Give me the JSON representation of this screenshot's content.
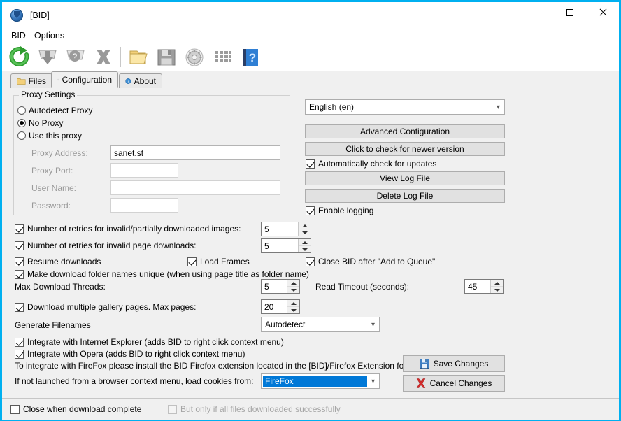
{
  "window": {
    "title": "[BID]",
    "app_icon": "bid-shield-icon",
    "minimize": "minimize-icon",
    "maximize": "maximize-icon",
    "close": "close-icon"
  },
  "menubar": {
    "items": [
      {
        "label": "BID"
      },
      {
        "label": "Options"
      }
    ]
  },
  "toolbar": {
    "items": [
      {
        "name": "refresh-icon",
        "title": "Refresh"
      },
      {
        "name": "download-icon",
        "title": "Download"
      },
      {
        "name": "help-disk-icon",
        "title": "Help"
      },
      {
        "name": "cancel-x-icon",
        "title": "Stop"
      },
      {
        "name": "folder-icon",
        "title": "Open Folder"
      },
      {
        "name": "save-floppy-icon",
        "title": "Save"
      },
      {
        "name": "gear-disc-icon",
        "title": "Settings"
      },
      {
        "name": "grid-icon",
        "title": "Thumbnails"
      },
      {
        "name": "help-book-icon",
        "title": "Help Book"
      }
    ]
  },
  "tabs": [
    {
      "label": "Files",
      "icon": "folder-icon",
      "active": false
    },
    {
      "label": "Configuration",
      "icon": "gear-icon",
      "active": true
    },
    {
      "label": "About",
      "icon": "info-icon",
      "active": false
    }
  ],
  "proxy": {
    "group_title": "Proxy Settings",
    "options": [
      {
        "label": "Autodetect Proxy",
        "checked": false
      },
      {
        "label": "No Proxy",
        "checked": true
      },
      {
        "label": "Use this proxy",
        "checked": false
      }
    ],
    "fields": [
      {
        "label": "Proxy Address:",
        "value": "sanet.st",
        "placeholder": ""
      },
      {
        "label": "Proxy Port:",
        "value": "",
        "placeholder": ""
      },
      {
        "label": "User Name:",
        "value": "",
        "placeholder": ""
      },
      {
        "label": "Password:",
        "value": "",
        "placeholder": ""
      }
    ]
  },
  "right_panel": {
    "language": {
      "value": "English (en)"
    },
    "advanced_config_button": "Advanced Configuration",
    "check_version_button": "Click to check for newer version",
    "auto_check_updates": {
      "label": "Automatically check for updates",
      "checked": true
    },
    "view_log_button": "View Log File",
    "delete_log_button": "Delete Log File",
    "enable_logging": {
      "label": "Enable logging",
      "checked": true
    }
  },
  "options": {
    "retries_images": {
      "label": "Number of retries for invalid/partially downloaded images:",
      "checked": true,
      "value": "5"
    },
    "retries_pages": {
      "label": "Number of retries for invalid page downloads:",
      "checked": true,
      "value": "5"
    },
    "resume_downloads": {
      "label": "Resume downloads",
      "checked": true
    },
    "load_frames": {
      "label": "Load Frames",
      "checked": true
    },
    "close_after_queue": {
      "label": "Close BID after \"Add to Queue\"",
      "checked": true
    },
    "unique_folder_names": {
      "label": "Make download folder names unique (when using page title as folder name)",
      "checked": true
    },
    "max_threads": {
      "label": "Max Download Threads:",
      "value": "5"
    },
    "read_timeout": {
      "label": "Read Timeout (seconds):",
      "value": "45"
    },
    "multiple_gallery": {
      "label": "Download multiple gallery pages. Max pages:",
      "checked": true,
      "value": "20"
    },
    "generate_filenames": {
      "label": "Generate Filenames",
      "value": "Autodetect"
    },
    "integrate_ie": {
      "label": "Integrate with Internet Explorer (adds BID to right click context menu)",
      "checked": true
    },
    "integrate_opera": {
      "label": "Integrate with Opera (adds BID to right click context menu)",
      "checked": true
    },
    "firefox_note": "To integrate with FireFox please install the BID Firefox extension located in the [BID]/Firefox Extension folder.",
    "cookies_label": "If not launched from a browser context menu, load cookies from:",
    "cookies_value": "FireFox"
  },
  "actions": {
    "save_label": "Save Changes",
    "save_icon": "save-floppy-icon",
    "cancel_label": "Cancel Changes",
    "cancel_icon": "red-x-icon"
  },
  "statusbar": {
    "close_when_complete": {
      "label": "Close when download complete",
      "checked": false
    },
    "only_if_success": {
      "label": "But only if all files downloaded successfully",
      "checked": false,
      "disabled": true
    }
  },
  "colors": {
    "window_border": "#00b0f0",
    "accent_selection": "#0078d7",
    "panel_bg": "#f0f0f0",
    "disabled_text": "#9a9a9a"
  }
}
